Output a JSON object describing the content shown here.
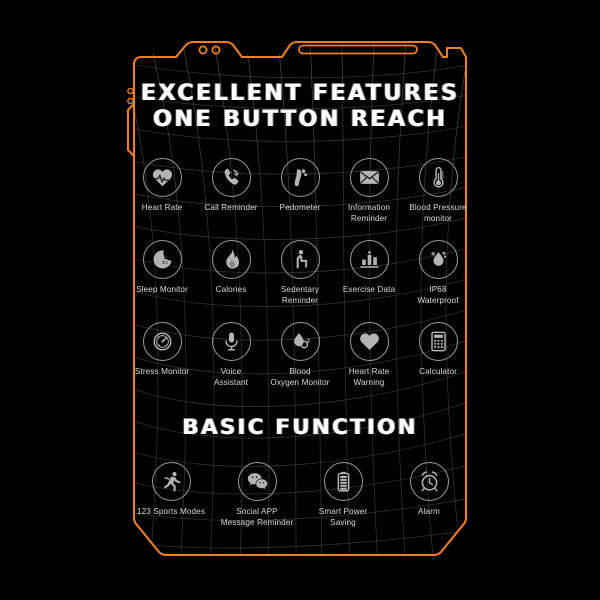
{
  "meta": {
    "background_color": "#000000",
    "outline_color": "#ef8022",
    "icon_stroke_color": "#9a9a9a",
    "icon_fill_color": "#b4b4b4",
    "label_color": "#d9d9d9",
    "grid_color": "#4a4a4a",
    "title_color": "#ffffff"
  },
  "header": {
    "title_line_1": "EXCELLENT FEATURES",
    "title_line_2": "ONE BUTTON REACH"
  },
  "features": {
    "rows": [
      [
        {
          "label": "Heart Rate",
          "icon": "heart-rate-icon"
        },
        {
          "label": "Call Reminder",
          "icon": "call-reminder-icon"
        },
        {
          "label": "Pedometer",
          "icon": "pedometer-icon"
        },
        {
          "label": "Information\nReminder",
          "icon": "information-reminder-icon"
        },
        {
          "label": "Blood Pressure\nmonitor",
          "icon": "blood-pressure-icon"
        }
      ],
      [
        {
          "label": "Sleep Monitor",
          "icon": "sleep-monitor-icon"
        },
        {
          "label": "Calories",
          "icon": "calories-icon"
        },
        {
          "label": "Sedentary\nReminder",
          "icon": "sedentary-reminder-icon"
        },
        {
          "label": "Exercise Data",
          "icon": "exercise-data-icon"
        },
        {
          "label": "IP68\nWaterproof",
          "icon": "waterproof-icon"
        }
      ],
      [
        {
          "label": "Stress Monitor",
          "icon": "stress-monitor-icon"
        },
        {
          "label": "Voice\nAssistant",
          "icon": "voice-assistant-icon"
        },
        {
          "label": "Blood\nOxygen Monitor",
          "icon": "blood-oxygen-icon"
        },
        {
          "label": "Heart Rate\nWarning",
          "icon": "heart-rate-warning-icon"
        },
        {
          "label": "Calculator",
          "icon": "calculator-icon"
        }
      ]
    ]
  },
  "basic": {
    "title": "BASIC FUNCTION",
    "items": [
      {
        "label": "123 Sports Modes",
        "icon": "sports-modes-icon"
      },
      {
        "label": "Social APP\nMessage Reminder",
        "icon": "social-app-icon"
      },
      {
        "label": "Smart Power\nSaving",
        "icon": "smart-power-saving-icon"
      },
      {
        "label": "Alarm",
        "icon": "alarm-icon"
      }
    ]
  },
  "device": {
    "camera_lens_count": 2,
    "speaker_grille": "speaker-grille",
    "side_button_count": 2
  }
}
